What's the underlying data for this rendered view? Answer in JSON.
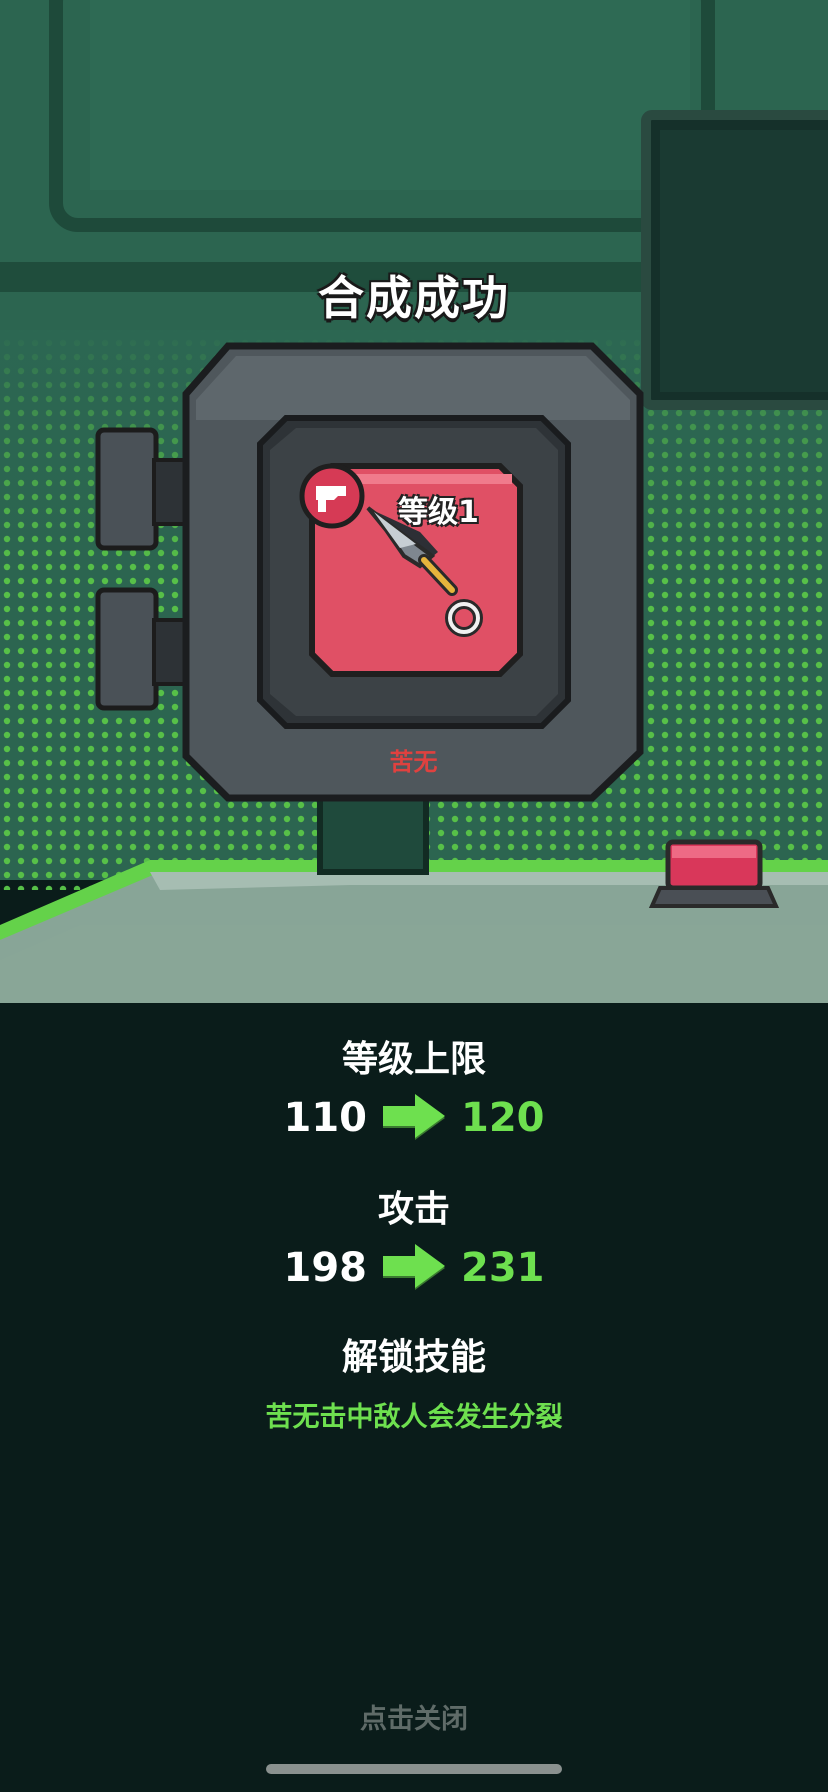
{
  "header": {
    "title": "合成成功"
  },
  "item": {
    "level_text": "等级1",
    "name": "苦无",
    "icon": "kunai-icon",
    "badge_icon": "pistol-icon"
  },
  "stats": [
    {
      "label": "等级上限",
      "from": "110",
      "to": "120"
    },
    {
      "label": "攻击",
      "from": "198",
      "to": "231"
    }
  ],
  "skill": {
    "label": "解锁技能",
    "text": "苦无击中敌人会发生分裂"
  },
  "footer": {
    "close_text": "点击关闭"
  },
  "colors": {
    "accent_green": "#6ee04f",
    "item_red": "#e0413f",
    "panel_bg": "#0a1c1a"
  }
}
